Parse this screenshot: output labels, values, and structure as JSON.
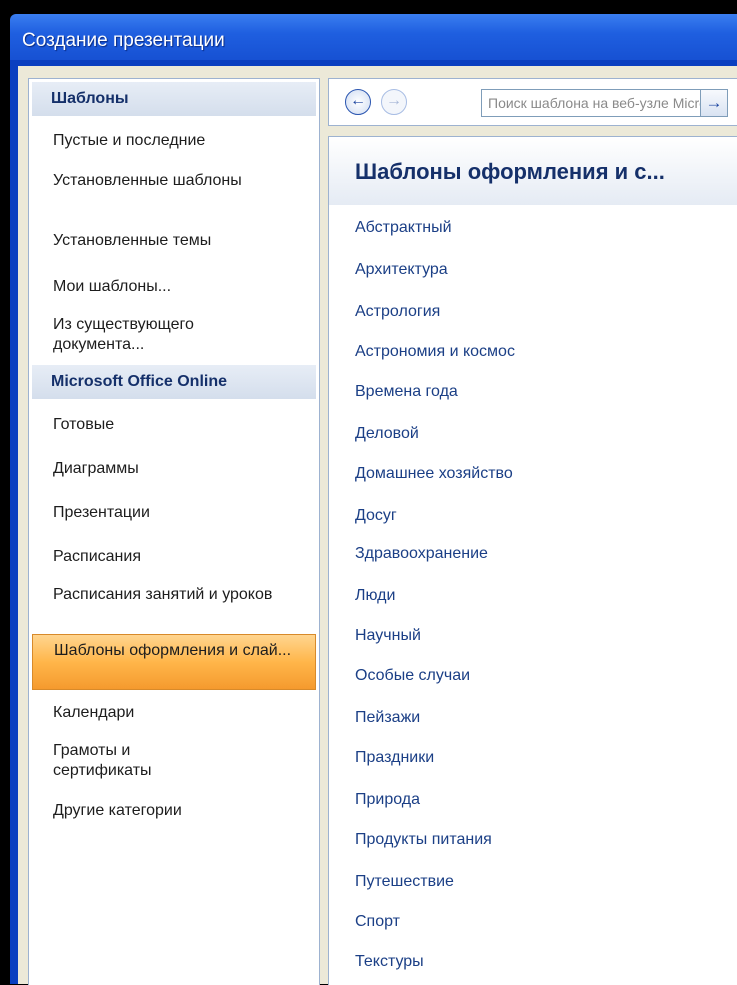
{
  "window": {
    "title": "Создание презентации"
  },
  "sidebar": {
    "section_templates": "Шаблоны",
    "items_local": [
      "Пустые и последние",
      "Установленные шаблоны",
      "Установленные темы",
      "Мои шаблоны...",
      "Из существующего документа..."
    ],
    "section_online": "Microsoft Office Online",
    "items_online": [
      "Готовые",
      "Диаграммы",
      "Презентации",
      "Расписания",
      "Расписания занятий и уроков",
      "Шаблоны оформления и слай...",
      "Календари",
      "Грамоты и сертификаты",
      "Другие категории"
    ],
    "selected_index_online": 5
  },
  "toolbar": {
    "back_icon": "arrow-left-icon",
    "forward_icon": "arrow-right-icon",
    "search_placeholder": "Поиск шаблона на веб-узле Microsoft Office Online",
    "search_go_icon": "arrow-right-icon"
  },
  "main": {
    "header": "Шаблоны оформления и с...",
    "categories": [
      "Абстрактный",
      "Архитектура",
      "Астрология",
      "Астрономия и космос",
      "Времена года",
      "Деловой",
      "Домашнее хозяйство",
      "Досуг",
      "Здравоохранение",
      "Люди",
      "Научный",
      "Особые случаи",
      "Пейзажи",
      "Праздники",
      "Природа",
      "Продукты питания",
      "Путешествие",
      "Спорт",
      "Текстуры"
    ]
  }
}
